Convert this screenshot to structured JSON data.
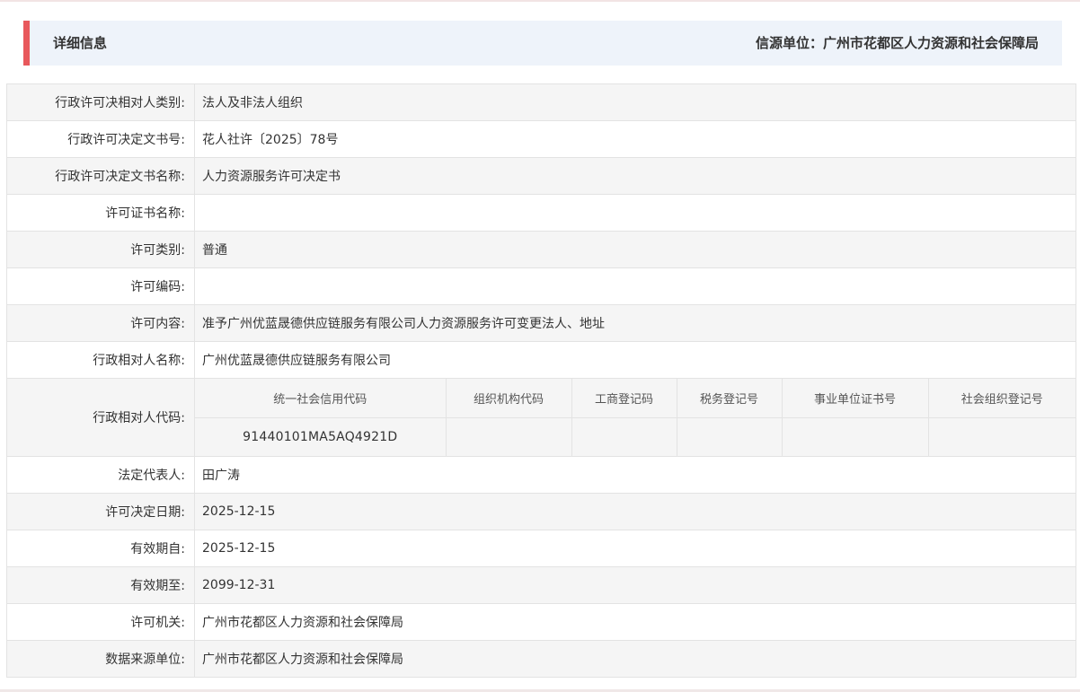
{
  "header": {
    "title": "详细信息",
    "source": "信源单位：广州市花都区人力资源和社会保障局",
    "accent_color": "#e8585c"
  },
  "rows": [
    {
      "label": "行政许可决相对人类别:",
      "value": "法人及非法人组织"
    },
    {
      "label": "行政许可决定文书号:",
      "value": "花人社许〔2025〕78号"
    },
    {
      "label": "行政许可决定文书名称:",
      "value": "人力资源服务许可决定书"
    },
    {
      "label": "许可证书名称:",
      "value": ""
    },
    {
      "label": "许可类别:",
      "value": "普通"
    },
    {
      "label": "许可编码:",
      "value": ""
    },
    {
      "label": "许可内容:",
      "value": "准予广州优蓝晟德供应链服务有限公司人力资源服务许可变更法人、地址"
    },
    {
      "label": "行政相对人名称:",
      "value": "广州优蓝晟德供应链服务有限公司"
    }
  ],
  "code_row": {
    "label": "行政相对人代码:",
    "headers": [
      "统一社会信用代码",
      "组织机构代码",
      "工商登记码",
      "税务登记号",
      "事业单位证书号",
      "社会组织登记号"
    ],
    "values": [
      "91440101MA5AQ4921D",
      "",
      "",
      "",
      "",
      ""
    ]
  },
  "rows_after": [
    {
      "label": "法定代表人:",
      "value": "田广涛"
    },
    {
      "label": "许可决定日期:",
      "value": "2025-12-15"
    },
    {
      "label": "有效期自:",
      "value": "2025-12-15"
    },
    {
      "label": "有效期至:",
      "value": "2099-12-31"
    },
    {
      "label": "许可机关:",
      "value": "广州市花都区人力资源和社会保障局"
    },
    {
      "label": "数据来源单位:",
      "value": "广州市花都区人力资源和社会保障局"
    }
  ]
}
